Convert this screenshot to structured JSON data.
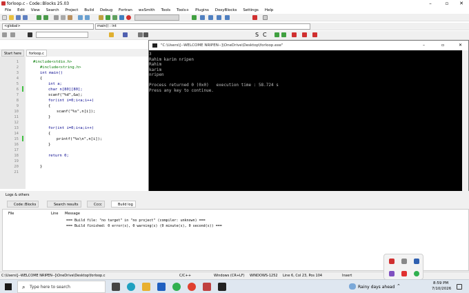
{
  "window": {
    "title": "forloop.c - Code::Blocks 25.03"
  },
  "menu": [
    "File",
    "Edit",
    "View",
    "Search",
    "Project",
    "Build",
    "Debug",
    "Fortran",
    "wxSmith",
    "Tools",
    "Tools+",
    "Plugins",
    "DoxyBlocks",
    "Settings",
    "Help"
  ],
  "toolbar": {
    "scope_combo": "<global>",
    "func_combo": "main() : int"
  },
  "tabs": {
    "start_here": "Start here",
    "forloop": "forloop.c"
  },
  "editor": {
    "lines": [
      {
        "n": "1",
        "code": "#include<stdio.h>"
      },
      {
        "n": "2",
        "code": "#include<string.h>"
      },
      {
        "n": "3",
        "code": "int main()"
      },
      {
        "n": "4",
        "code": "{"
      },
      {
        "n": "5",
        "code": "int a;"
      },
      {
        "n": "6",
        "code": "char n[80][80];"
      },
      {
        "n": "7",
        "code": "scanf(\"%d\",&a);"
      },
      {
        "n": "8",
        "code": "for(int i=0;i<a;i++)"
      },
      {
        "n": "9",
        "code": "{"
      },
      {
        "n": "10",
        "code": "scanf(\"%s\",n[i]);"
      },
      {
        "n": "11",
        "code": "}"
      },
      {
        "n": "12",
        "code": ""
      },
      {
        "n": "13",
        "code": "for(int i=0;i<a;i++)"
      },
      {
        "n": "14",
        "code": "{"
      },
      {
        "n": "15",
        "code": "printf(\"%s\\n\",n[i]);"
      },
      {
        "n": "16",
        "code": "}"
      },
      {
        "n": "17",
        "code": ""
      },
      {
        "n": "18",
        "code": "return 0;"
      },
      {
        "n": "19",
        "code": ""
      },
      {
        "n": "20",
        "code": "}"
      },
      {
        "n": "21",
        "code": ""
      }
    ]
  },
  "console": {
    "title": "\"C:\\Users\\[--WELCOME NRIPEN--]\\OneDrive\\Desktop\\forloop.exe\"",
    "output": "3\nRahim karim nripen\nRahim\nkarim\nnripen\n\nProcess returned 0 (0x0)   execution time : 58.724 s\nPress any key to continue."
  },
  "logs": {
    "title": "Logs & others",
    "tabs": [
      "Code::Blocks",
      "Search results",
      "Cccc",
      "Build log"
    ],
    "headers": {
      "file": "File",
      "line": "Line",
      "message": "Message"
    },
    "messages": [
      "=== Build file: \"no target\" in \"no project\" (compiler: unknown) ===",
      "=== Build finished: 0 error(s), 0 warning(s) (0 minute(s), 0 second(s)) ==="
    ]
  },
  "status": {
    "path": "C:\\Users\\[--WELCOME NRIPEN--]\\OneDrive\\Desktop\\forloop.c",
    "lang": "C/C++",
    "eol": "Windows (CR+LF)",
    "encoding": "WINDOWS-1252",
    "position": "Line 6, Col 23, Pos 104",
    "mode": "Insert"
  },
  "taskbar": {
    "search_placeholder": "Type here to search",
    "weather": "Rainy days ahead",
    "time": "8:59 PM",
    "date": "7/10/2026"
  }
}
